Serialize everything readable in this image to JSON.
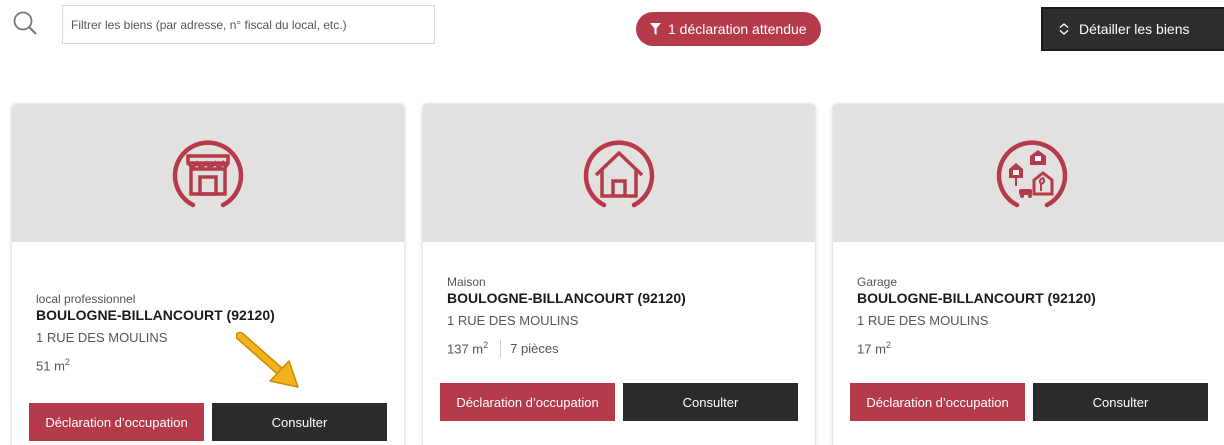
{
  "search": {
    "placeholder": "Filtrer les biens (par adresse, n° fiscal du local, etc.)"
  },
  "filter_badge": {
    "label": "1 déclaration attendue",
    "icon": "filter-icon"
  },
  "detail_button": {
    "label": "Détailler les biens",
    "icon": "expand-icon"
  },
  "colors": {
    "accent": "#b53a4a",
    "dark": "#2b2b2b",
    "card_header": "#e3e0e0"
  },
  "cards": [
    {
      "icon": "shop-icon",
      "type": "local professionnel",
      "city": "BOULOGNE-BILLANCOURT (92120)",
      "address": "1 RUE DES MOULINS",
      "surface": "51 m",
      "surface_exp": "2",
      "rooms": "",
      "declaration_label": "Déclaration d’occupation",
      "consult_label": "Consulter"
    },
    {
      "icon": "house-icon",
      "type": "Maison",
      "city": "BOULOGNE-BILLANCOURT (92120)",
      "address": "1 RUE DES MOULINS",
      "surface": "137 m",
      "surface_exp": "2",
      "rooms": "7 pièces",
      "declaration_label": "Déclaration d’occupation",
      "consult_label": "Consulter"
    },
    {
      "icon": "garage-icon",
      "type": "Garage",
      "city": "BOULOGNE-BILLANCOURT (92120)",
      "address": "1 RUE DES MOULINS",
      "surface": "17 m",
      "surface_exp": "2",
      "rooms": "",
      "declaration_label": "Déclaration d’occupation",
      "consult_label": "Consulter"
    }
  ]
}
